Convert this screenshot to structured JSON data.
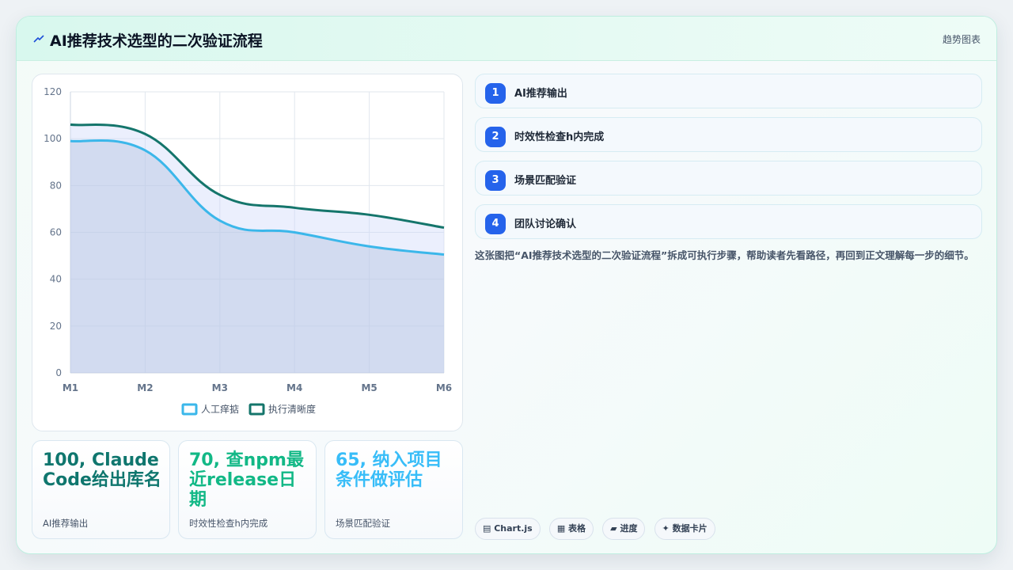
{
  "header": {
    "title": "AI推荐技术选型的二次验证流程",
    "tag": "趋势图表"
  },
  "chart_data": {
    "type": "area",
    "categories": [
      "M1",
      "M2",
      "M3",
      "M4",
      "M5",
      "M6"
    ],
    "series": [
      {
        "name": "人工痒掂",
        "values": [
          99,
          95,
          65,
          60,
          54,
          50.5
        ],
        "color": "#3bb7ea",
        "fill": "rgba(180,195,225,0.45)"
      },
      {
        "name": "执行清晰度",
        "values": [
          106,
          102,
          76,
          70.5,
          67.5,
          62
        ],
        "color": "#14756b",
        "fill": "rgba(205,215,250,0.40)"
      }
    ],
    "ylim": [
      0,
      120
    ],
    "yticks": [
      0,
      20,
      40,
      60,
      80,
      100,
      120
    ],
    "grid": true,
    "legend_position": "bottom"
  },
  "steps": [
    {
      "num": "1",
      "label": "AI推荐输出"
    },
    {
      "num": "2",
      "label": "时效性检查h内完成"
    },
    {
      "num": "3",
      "label": "场景匹配验证"
    },
    {
      "num": "4",
      "label": "团队讨论确认"
    }
  ],
  "description": "这张图把“AI推荐技术选型的二次验证流程”拆成可执行步骤，帮助读者先看路径，再回到正文理解每一步的细节。",
  "stats": [
    {
      "value": "100, Claude Code给出库名",
      "label": "AI推荐输出",
      "color": "#0f766e"
    },
    {
      "value": "70, 查npm最近release日期",
      "label": "时效性检查h内完成",
      "color": "#12b886"
    },
    {
      "value": "65, 纳入项目条件做评估",
      "label": "场景匹配验证",
      "color": "#38bdf8"
    }
  ],
  "chips": [
    "▤ Chart.js",
    "▦ 表格",
    "▰ 进度",
    "✦ 数据卡片"
  ]
}
